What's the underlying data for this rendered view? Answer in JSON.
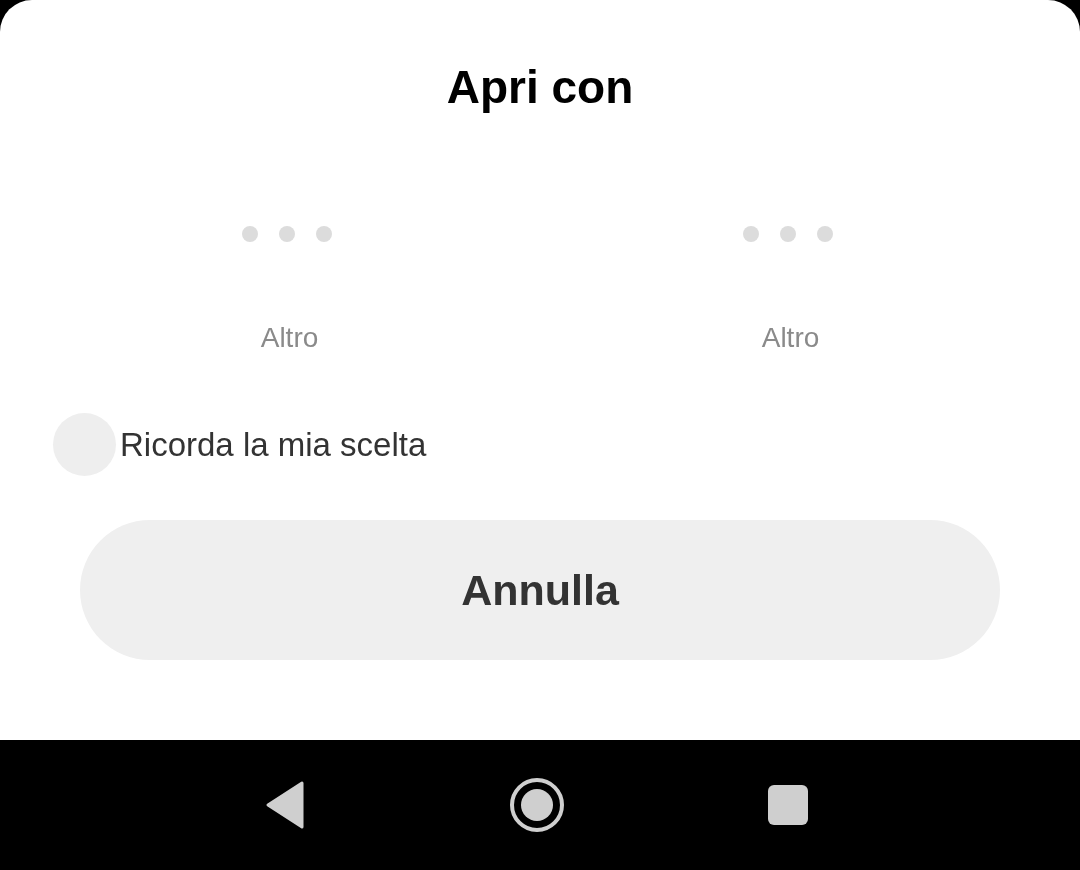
{
  "dialog": {
    "title": "Apri con"
  },
  "apps": [
    {
      "label": "Altro"
    },
    {
      "label": "Altro"
    }
  ],
  "remember_choice": {
    "label": "Ricorda la mia scelta",
    "checked": false
  },
  "cancel_button": {
    "label": "Annulla"
  }
}
